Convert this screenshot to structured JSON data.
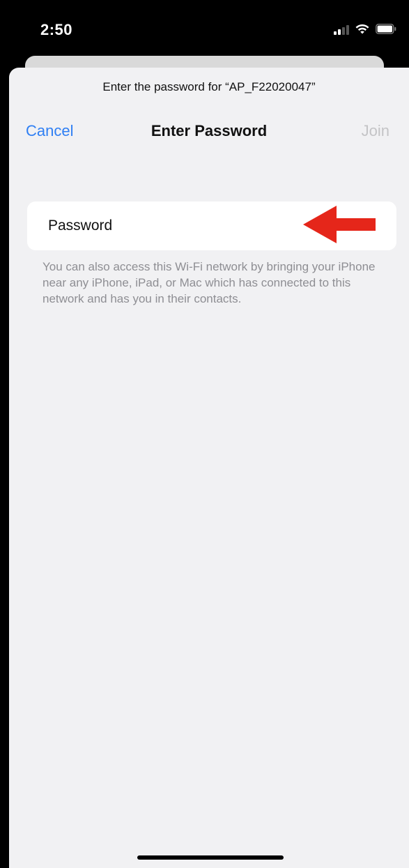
{
  "status_bar": {
    "time": "2:50",
    "signal_icon": "cellular-signal-icon",
    "wifi_icon": "wifi-icon",
    "battery_icon": "battery-icon"
  },
  "sheet": {
    "prompt": "Enter the password for “AP_F22020047”",
    "nav": {
      "cancel_label": "Cancel",
      "title": "Enter Password",
      "join_label": "Join"
    },
    "password_field": {
      "placeholder": "Password",
      "value": ""
    },
    "footnote": "You can also access this Wi-Fi network by bringing your iPhone near any iPhone, iPad, or Mac which has connected to this network and has you in their contacts."
  },
  "annotation": {
    "arrow_icon": "red-arrow-left-icon",
    "arrow_color": "#e5261a"
  },
  "colors": {
    "accent": "#2f7ff3",
    "disabled": "#c4c4c6",
    "sheet_background": "#f1f1f3",
    "secondary_text": "#8e8e93"
  }
}
